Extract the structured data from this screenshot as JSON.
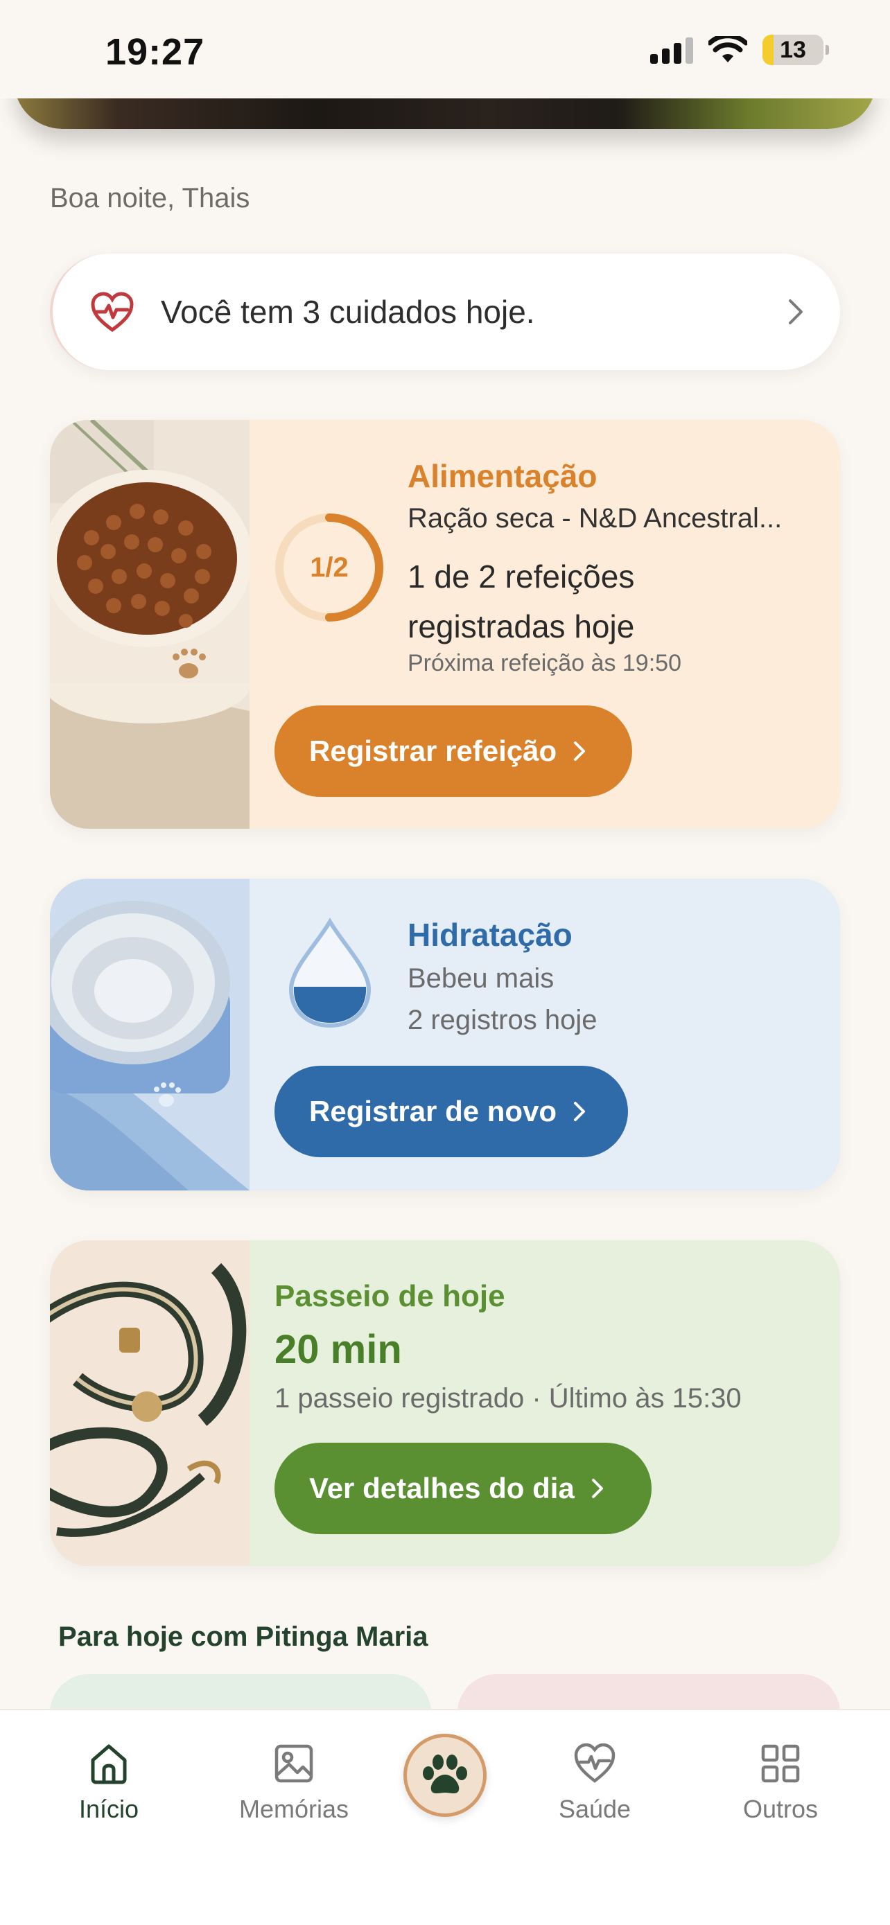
{
  "status_bar": {
    "time": "19:27",
    "battery": "13"
  },
  "greeting": "Boa noite, Thais",
  "care_banner": {
    "text": "Você tem 3 cuidados hoje."
  },
  "food_card": {
    "title": "Alimentação",
    "product": "Ração seca - N&D Ancestral...",
    "progress_label": "1/2",
    "progress": 0.5,
    "count_text": "1 de 2 refeições registradas hoje",
    "next_meal": "Próxima refeição às 19:50",
    "button_label": "Registrar refeição"
  },
  "water_card": {
    "title": "Hidratação",
    "subtitle": "Bebeu mais",
    "records": "2 registros hoje",
    "button_label": "Registrar de novo"
  },
  "walk_card": {
    "title": "Passeio de hoje",
    "duration": "20 min",
    "summary": "1 passeio registrado · Último às 15:30",
    "button_label": "Ver detalhes do dia"
  },
  "section_title": "Para hoje com Pitinga Maria",
  "tab_bar": {
    "home": "Início",
    "memories": "Memórias",
    "health": "Saúde",
    "more": "Outros"
  },
  "colors": {
    "food_accent": "#d9822b",
    "water_accent": "#2f6ba8",
    "walk_accent": "#5a8f32",
    "nav_active": "#24432c"
  }
}
